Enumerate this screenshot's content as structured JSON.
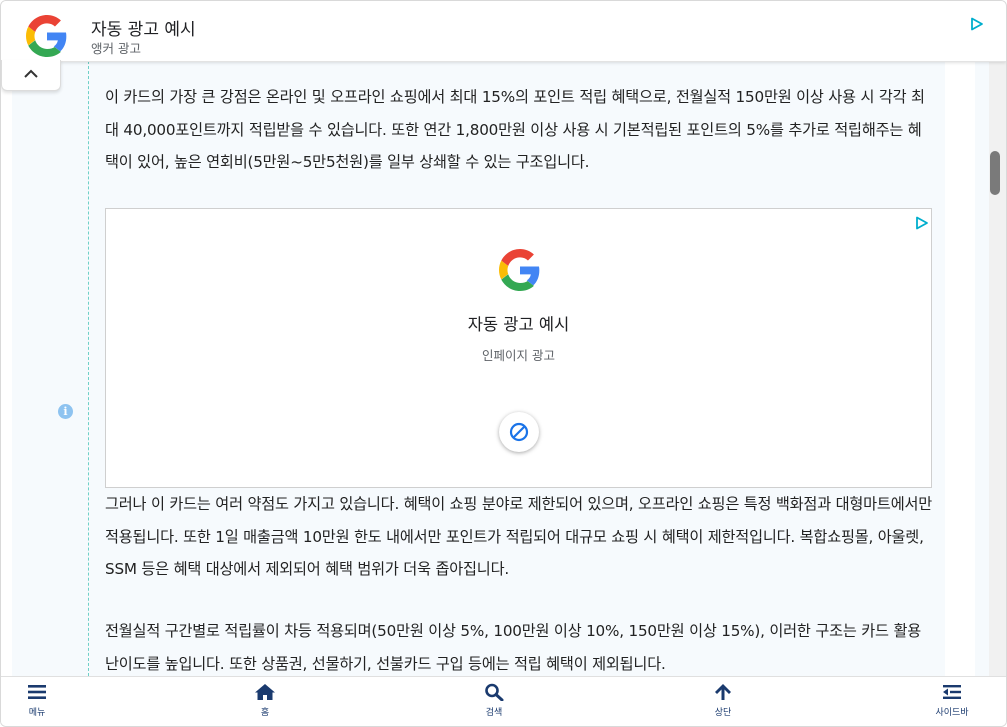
{
  "anchor_ad": {
    "title": "자동 광고 예시",
    "subtitle": "앵커 광고"
  },
  "article": {
    "paragraph1": "이 카드의 가장 큰 강점은 온라인 및 오프라인 쇼핑에서 최대 15%의 포인트 적립 혜택으로, 전월실적 150만원 이상 사용 시 각각 최대 40,000포인트까지 적립받을 수 있습니다. 또한 연간 1,800만원 이상 사용 시 기본적립된 포인트의 5%를 추가로 적립해주는 혜택이 있어, 높은 연회비(5만원~5만5천원)를 일부 상쇄할 수 있는 구조입니다.",
    "paragraph2": "그러나 이 카드는 여러 약점도 가지고 있습니다. 혜택이 쇼핑 분야로 제한되어 있으며, 오프라인 쇼핑은 특정 백화점과 대형마트에서만 적용됩니다. 또한 1일 매출금액 10만원 한도 내에서만 포인트가 적립되어 대규모 쇼핑 시 혜택이 제한적입니다. 복합쇼핑몰, 아울렛, SSM 등은 혜택 대상에서 제외되어 혜택 범위가 더욱 좁아집니다.",
    "paragraph3": "전월실적 구간별로 적립률이 차등 적용되며(50만원 이상 5%, 100만원 이상 10%, 150만원 이상 15%), 이러한 구조는 카드 활용 난이도를 높입니다. 또한 상품권, 선물하기, 선불카드 구입 등에는 적립 혜택이 제외됩니다."
  },
  "inpage_ad": {
    "title": "자동 광고 예시",
    "subtitle": "인페이지 광고"
  },
  "bottom_nav": [
    {
      "label": "메뉴",
      "icon": "menu-icon"
    },
    {
      "label": "홈",
      "icon": "home-icon"
    },
    {
      "label": "검색",
      "icon": "search-icon"
    },
    {
      "label": "상단",
      "icon": "arrow-up-icon"
    },
    {
      "label": "사이드바",
      "icon": "sidebar-icon"
    }
  ],
  "colors": {
    "nav_icon": "#1a3a6e",
    "page_bg": "#f6fafd",
    "dash_line": "#6fd0c7",
    "adchoice": "#00aecd"
  }
}
